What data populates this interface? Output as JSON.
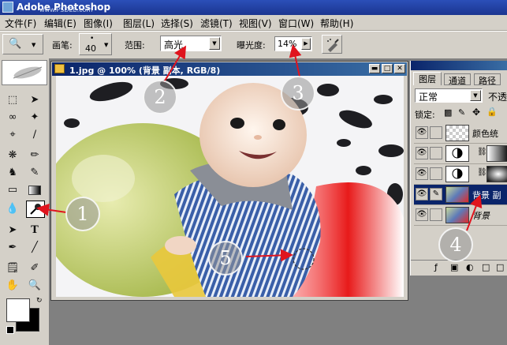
{
  "app": {
    "title": "Adobe Photoshop",
    "watermark": "www.PSDEE.com"
  },
  "menu": [
    "文件(F)",
    "编辑(E)",
    "图像(I)",
    "图层(L)",
    "选择(S)",
    "滤镜(T)",
    "视图(V)",
    "窗口(W)",
    "帮助(H)"
  ],
  "options": {
    "brush_label": "画笔:",
    "brush_size": "40",
    "range_label": "范围:",
    "range_value": "高光",
    "exposure_label": "曝光度:",
    "exposure_value": "14%"
  },
  "document": {
    "title": "1.jpg @ 100% (背景 副本, RGB/8)"
  },
  "layers_panel": {
    "tabs": [
      "图层",
      "通道",
      "路径"
    ],
    "blend_mode": "正常",
    "opacity_label": "不透",
    "lock_label": "锁定:",
    "layers": [
      {
        "name": "颜色统",
        "visible": true,
        "selected": false
      },
      {
        "name": "",
        "visible": true,
        "selected": false
      },
      {
        "name": "",
        "visible": true,
        "selected": false
      },
      {
        "name": "背景 副",
        "visible": true,
        "selected": true
      },
      {
        "name": "背景",
        "visible": true,
        "selected": false
      }
    ]
  },
  "callouts": [
    "1",
    "2",
    "3",
    "4",
    "5"
  ],
  "colors": {
    "accent_arrow": "#e0141e",
    "titlebar": "#1b3590",
    "selection": "#0a246a"
  }
}
